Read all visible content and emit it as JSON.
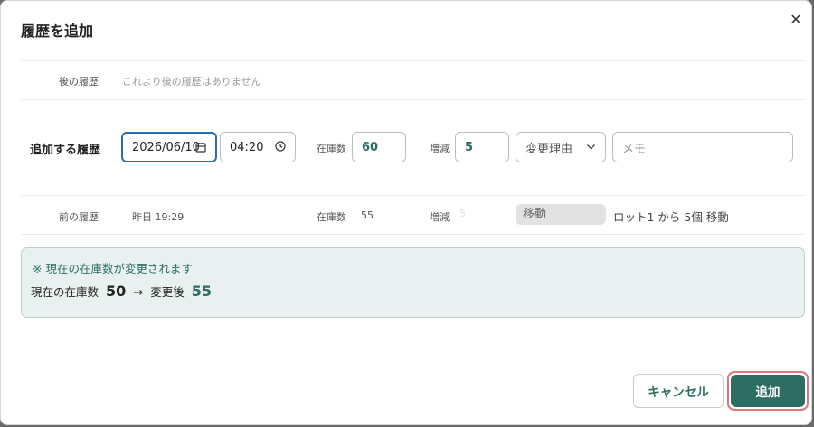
{
  "dialog": {
    "title": "履歴を追加",
    "close_icon": "close-icon",
    "close_glyph": "✕"
  },
  "later_history": {
    "label": "後の履歴",
    "empty_text": "これより後の履歴はありません"
  },
  "add_history": {
    "label": "追加する履歴",
    "date_value": "2026/06/10",
    "date_icon": "calendar-icon",
    "time_value": "04:20",
    "time_icon": "clock-icon",
    "stock_label": "在庫数",
    "stock_value": "60",
    "change_label": "増減",
    "change_value": "5",
    "reason_placeholder": "変更理由",
    "reason_icon": "chevron-down-icon",
    "memo_placeholder": "メモ"
  },
  "previous_history": {
    "label": "前の履歴",
    "datetime": "昨日 19:29",
    "stock_label": "在庫数",
    "stock_value": "55",
    "change_label": "増減",
    "change_value": "5",
    "reason": "移動",
    "memo": "ロット1 から 5個 移動"
  },
  "notice": {
    "message": "※ 現在の在庫数が変更されます",
    "current_label": "現在の在庫数",
    "current_value": "50",
    "arrow": "→",
    "after_label": "変更後",
    "after_value": "55"
  },
  "footer": {
    "cancel_label": "キャンセル",
    "add_label": "追加"
  },
  "colors": {
    "accent": "#2d6d63",
    "focus": "#2b6cb0",
    "notice_bg": "#e9f1f0"
  }
}
